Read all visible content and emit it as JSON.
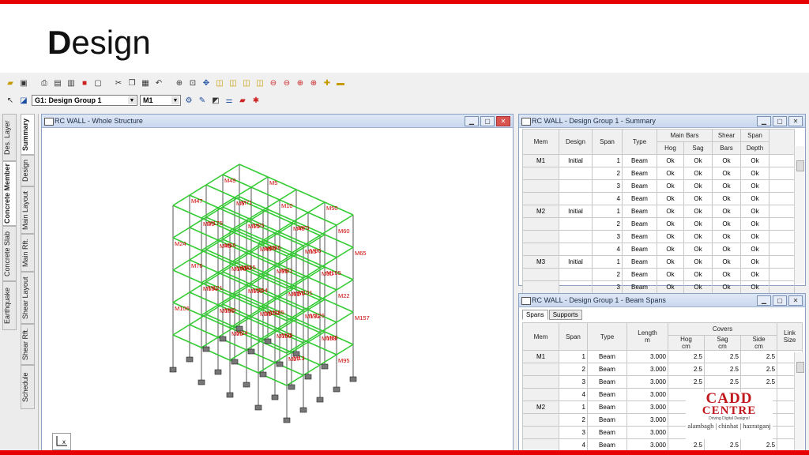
{
  "slide": {
    "title_first": "D",
    "title_rest": "esign"
  },
  "toolbar": {
    "group_select": "G1: Design Group 1",
    "member_select": "M1"
  },
  "left_tabs": {
    "outer": [
      "Des. Layer",
      "Concrete Member",
      "Concrete Slab",
      "Earthquake"
    ],
    "inner": [
      "Summary",
      "Design",
      "Main Layout",
      "Main Rft.",
      "Shear Layout",
      "Shear Rft.",
      "Schedule"
    ]
  },
  "structure_window": {
    "title": "RC WALL - Whole Structure",
    "member_labels": [
      "M5",
      "M50",
      "M49",
      "M10",
      "M60",
      "M5",
      "M48",
      "M47",
      "M10",
      "M15",
      "M20",
      "M46",
      "M71",
      "M70",
      "M65",
      "M25",
      "M96",
      "M175",
      "M66",
      "M30",
      "M45",
      "M91",
      "M24",
      "M170",
      "M61",
      "M86",
      "M165",
      "M56",
      "M81",
      "M22",
      "M160",
      "M51",
      "M76",
      "M105",
      "M131",
      "M131",
      "M21",
      "M155",
      "M101",
      "M157",
      "M154",
      "M126",
      "M121",
      "M152",
      "M153",
      "M151",
      "M159",
      "M106",
      "M25",
      "M27",
      "M185",
      "M88",
      "M40",
      "M35",
      "M95",
      "M24",
      "M13"
    ]
  },
  "summary_window": {
    "title": "RC WALL - Design Group 1 - Summary",
    "headers": {
      "mem": "Mem",
      "design": "Design",
      "span": "Span",
      "type": "Type",
      "main_bars": "Main Bars",
      "hog": "Hog",
      "sag": "Sag",
      "shear": "Shear",
      "bars": "Bars",
      "span_depth_1": "Span",
      "span_depth_2": "Depth"
    },
    "rows": [
      {
        "mem": "M1",
        "design": "Initial",
        "span": "1",
        "type": "Beam",
        "hog": "Ok",
        "sag": "Ok",
        "shear": "Ok",
        "depth": "Ok"
      },
      {
        "mem": "",
        "design": "",
        "span": "2",
        "type": "Beam",
        "hog": "Ok",
        "sag": "Ok",
        "shear": "Ok",
        "depth": "Ok"
      },
      {
        "mem": "",
        "design": "",
        "span": "3",
        "type": "Beam",
        "hog": "Ok",
        "sag": "Ok",
        "shear": "Ok",
        "depth": "Ok"
      },
      {
        "mem": "",
        "design": "",
        "span": "4",
        "type": "Beam",
        "hog": "Ok",
        "sag": "Ok",
        "shear": "Ok",
        "depth": "Ok"
      },
      {
        "mem": "M2",
        "design": "Initial",
        "span": "1",
        "type": "Beam",
        "hog": "Ok",
        "sag": "Ok",
        "shear": "Ok",
        "depth": "Ok"
      },
      {
        "mem": "",
        "design": "",
        "span": "2",
        "type": "Beam",
        "hog": "Ok",
        "sag": "Ok",
        "shear": "Ok",
        "depth": "Ok"
      },
      {
        "mem": "",
        "design": "",
        "span": "3",
        "type": "Beam",
        "hog": "Ok",
        "sag": "Ok",
        "shear": "Ok",
        "depth": "Ok"
      },
      {
        "mem": "",
        "design": "",
        "span": "4",
        "type": "Beam",
        "hog": "Ok",
        "sag": "Ok",
        "shear": "Ok",
        "depth": "Ok"
      },
      {
        "mem": "M3",
        "design": "Initial",
        "span": "1",
        "type": "Beam",
        "hog": "Ok",
        "sag": "Ok",
        "shear": "Ok",
        "depth": "Ok"
      },
      {
        "mem": "",
        "design": "",
        "span": "2",
        "type": "Beam",
        "hog": "Ok",
        "sag": "Ok",
        "shear": "Ok",
        "depth": "Ok"
      },
      {
        "mem": "",
        "design": "",
        "span": "3",
        "type": "Beam",
        "hog": "Ok",
        "sag": "Ok",
        "shear": "Ok",
        "depth": "Ok"
      }
    ]
  },
  "spans_window": {
    "title": "RC WALL - Design Group 1 - Beam Spans",
    "tabs": [
      "Spans",
      "Supports"
    ],
    "headers": {
      "mem": "Mem",
      "span": "Span",
      "type": "Type",
      "length": "Length",
      "length_unit": "m",
      "covers": "Covers",
      "hog": "Hog",
      "sag": "Sag",
      "side": "Side",
      "cm": "cm",
      "link1": "Link",
      "link2": "Size"
    },
    "rows": [
      {
        "mem": "M1",
        "span": "1",
        "type": "Beam",
        "length": "3.000",
        "hog": "2.5",
        "sag": "2.5",
        "side": "2.5"
      },
      {
        "mem": "",
        "span": "2",
        "type": "Beam",
        "length": "3.000",
        "hog": "2.5",
        "sag": "2.5",
        "side": "2.5"
      },
      {
        "mem": "",
        "span": "3",
        "type": "Beam",
        "length": "3.000",
        "hog": "2.5",
        "sag": "2.5",
        "side": "2.5"
      },
      {
        "mem": "",
        "span": "4",
        "type": "Beam",
        "length": "3.000",
        "hog": "",
        "sag": "",
        "side": ""
      },
      {
        "mem": "M2",
        "span": "1",
        "type": "Beam",
        "length": "3.000",
        "hog": "",
        "sag": "",
        "side": ""
      },
      {
        "mem": "",
        "span": "2",
        "type": "Beam",
        "length": "3.000",
        "hog": "",
        "sag": "",
        "side": ""
      },
      {
        "mem": "",
        "span": "3",
        "type": "Beam",
        "length": "3.000",
        "hog": "",
        "sag": "",
        "side": ""
      },
      {
        "mem": "",
        "span": "4",
        "type": "Beam",
        "length": "3.000",
        "hog": "2.5",
        "sag": "2.5",
        "side": "2.5"
      }
    ]
  },
  "logo": {
    "line1": "CADD",
    "line2": "CENTRE",
    "tagline": "Driving Digital Designs!",
    "branches": "alambagh | chinhat | hazratganj"
  },
  "colors": {
    "accent": "#e60000",
    "frame": "#33cc33",
    "labels": "#cc0000"
  }
}
